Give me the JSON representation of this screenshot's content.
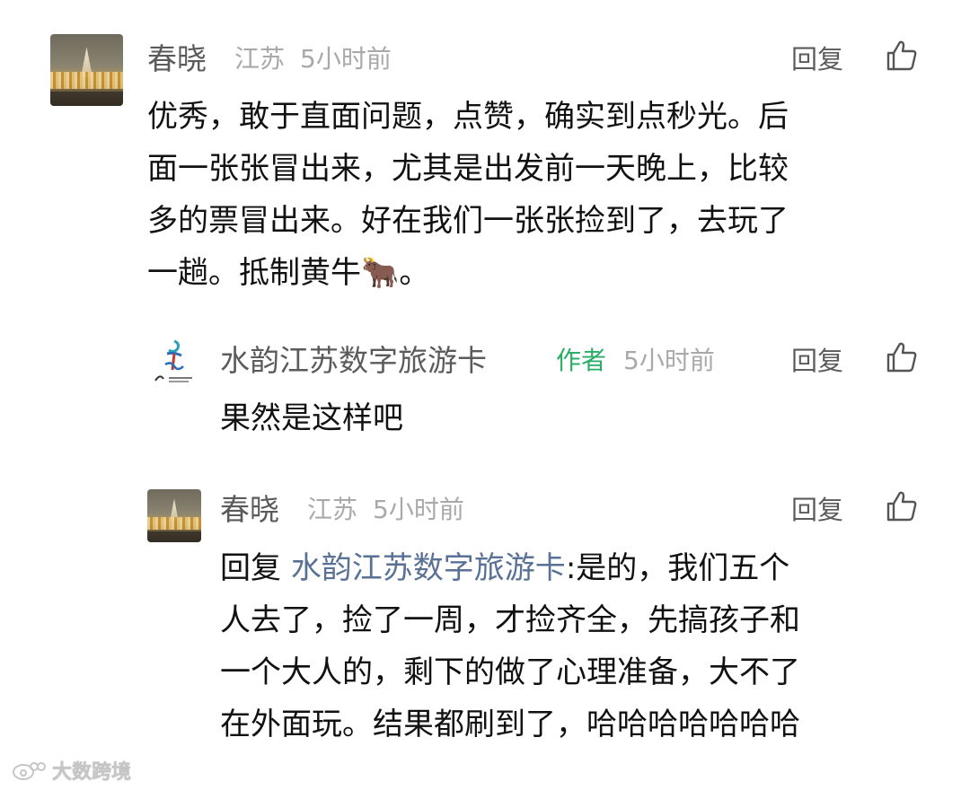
{
  "comments": [
    {
      "name": "春晓",
      "location": "江苏",
      "time": "5小时前",
      "reply_label": "回复",
      "avatar_icon": "photo-avatar",
      "lines": [
        "优秀，敢于直面问题，点赞，确实到点秒光。后",
        "面一张张冒出来，尤其是出发前一天晚上，比较",
        "多的票冒出来。好在我们一张张捡到了，去玩了",
        "一趟。抵制黄牛🐂。"
      ]
    },
    {
      "name": "水韵江苏数字旅游卡",
      "author_tag": "作者",
      "time": "5小时前",
      "reply_label": "回复",
      "avatar_icon": "logo-avatar",
      "lines": [
        "果然是这样吧"
      ]
    },
    {
      "name": "春晓",
      "location": "江苏",
      "time": "5小时前",
      "reply_label": "回复",
      "avatar_icon": "photo-avatar",
      "reply_prefix": "回复 ",
      "reply_target": "水韵江苏数字旅游卡",
      "lines": [
        ":是的，我们五个",
        "人去了，捡了一周，才捡齐全，先搞孩子和",
        "一个大人的，剩下的做了心理准备，大不了",
        "在外面玩。结果都刷到了，哈哈哈哈哈哈哈"
      ]
    }
  ],
  "watermark": {
    "text": "大数跨境",
    "icon": "weibo-logo-icon"
  },
  "colors": {
    "name": "#5b5b5b",
    "meta": "#a9a9a9",
    "author_tag": "#2aae67",
    "reply_target": "#5a7196",
    "body": "#111111"
  }
}
